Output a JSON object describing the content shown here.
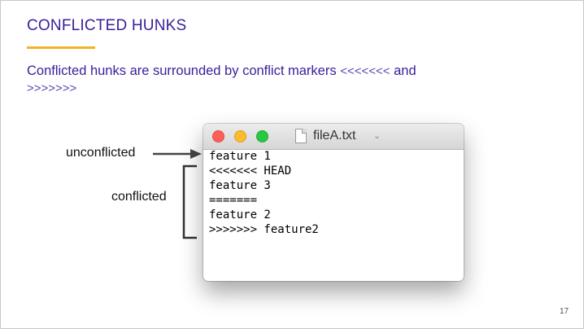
{
  "slide": {
    "title": "CONFLICTED HUNKS",
    "body_prefix": "Conflicted hunks are surrounded by conflict markers ",
    "marker_open": "<<<<<<<",
    "body_and": " and",
    "marker_close": ">>>>>>>",
    "page_number": "17"
  },
  "window": {
    "title": "fileA.txt",
    "lines": [
      "feature 1",
      "<<<<<<< HEAD",
      "feature 3",
      "=======",
      "feature 2",
      ">>>>>>> feature2"
    ]
  },
  "annotations": {
    "unconflicted": "unconflicted",
    "conflicted": "conflicted"
  },
  "colors": {
    "title": "#3a1e9a",
    "accent_underline": "#f0b323",
    "close": "#fc5f57",
    "minimize": "#fdbc2e",
    "maximize": "#28c840"
  }
}
